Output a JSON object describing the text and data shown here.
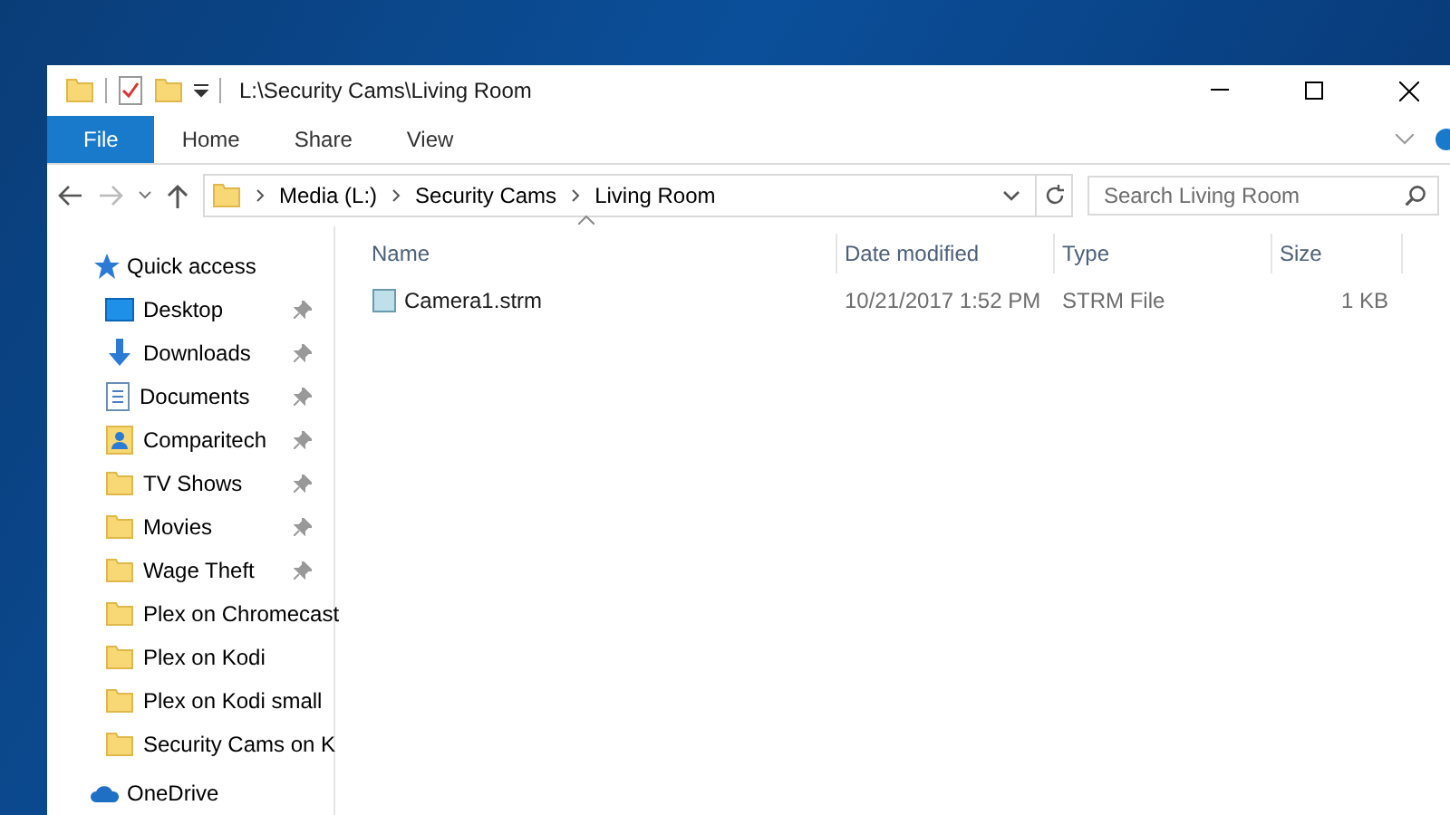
{
  "window": {
    "title": "L:\\Security Cams\\Living Room"
  },
  "ribbon_tabs": [
    {
      "label": "File",
      "selected": true
    },
    {
      "label": "Home",
      "selected": false
    },
    {
      "label": "Share",
      "selected": false
    },
    {
      "label": "View",
      "selected": false
    }
  ],
  "address": {
    "path": [
      "Media (L:)",
      "Security Cams",
      "Living Room"
    ]
  },
  "search": {
    "placeholder": "Search Living Room"
  },
  "sidebar": {
    "header": "Quick access",
    "items": [
      {
        "label": "Desktop",
        "kind": "desktop",
        "pinned": true
      },
      {
        "label": "Downloads",
        "kind": "downloads",
        "pinned": true
      },
      {
        "label": "Documents",
        "kind": "documents",
        "pinned": true
      },
      {
        "label": "Comparitech",
        "kind": "contact",
        "pinned": true
      },
      {
        "label": "TV Shows",
        "kind": "folder",
        "pinned": true
      },
      {
        "label": "Movies",
        "kind": "folder",
        "pinned": true
      },
      {
        "label": "Wage Theft",
        "kind": "folder",
        "pinned": true
      },
      {
        "label": "Plex on Chromecast",
        "kind": "folder",
        "pinned": false
      },
      {
        "label": "Plex on Kodi",
        "kind": "folder",
        "pinned": false
      },
      {
        "label": "Plex on Kodi small",
        "kind": "folder",
        "pinned": false
      },
      {
        "label": "Security Cams on K",
        "kind": "folder",
        "pinned": false
      }
    ],
    "footer": "OneDrive"
  },
  "table": {
    "columns": [
      "Name",
      "Date modified",
      "Type",
      "Size"
    ],
    "rows": [
      {
        "name": "Camera1.strm",
        "date": "10/21/2017 1:52 PM",
        "type": "STRM File",
        "size": "1 KB"
      }
    ]
  }
}
